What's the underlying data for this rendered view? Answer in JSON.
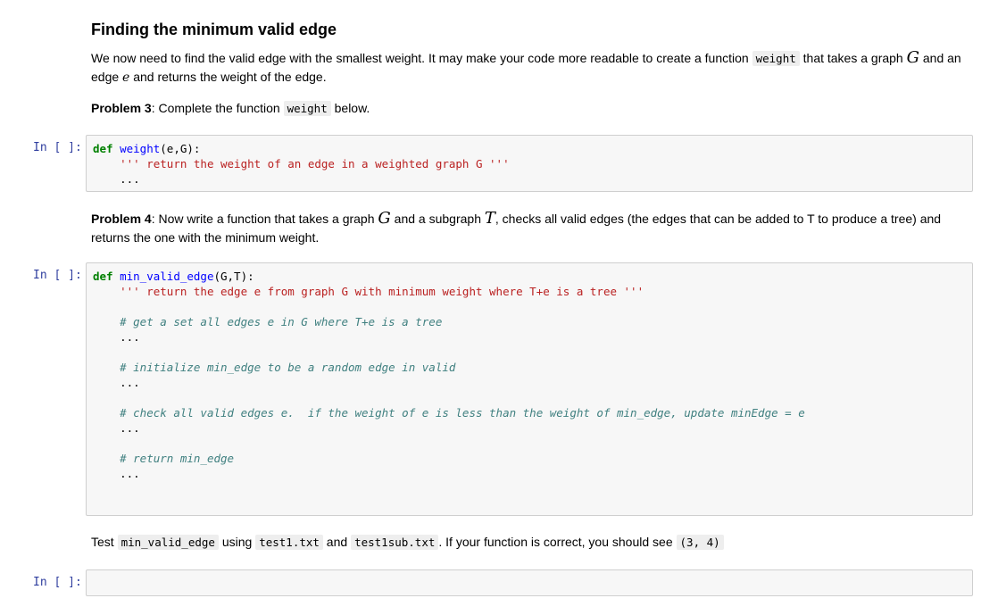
{
  "section": {
    "title": "Finding the minimum valid edge",
    "intro": {
      "t1": "We now need to find the valid edge with the smallest weight. It may make your code more readable to create a function ",
      "code1": "weight",
      "t2": " that takes a graph ",
      "m1": "G",
      "t3": " and an edge ",
      "m2": "e",
      "t4": " and returns the weight of the edge."
    }
  },
  "problem3": {
    "label": "Problem 3",
    "t1": ": Complete the function ",
    "code": "weight",
    "t2": " below."
  },
  "cell1": {
    "prompt": "In [ ]:",
    "def": "def",
    "fname": "weight",
    "args": "(e,G):",
    "doc": "''' return the weight of an edge in a weighted graph G '''",
    "ellipsis": "..."
  },
  "problem4": {
    "label": "Problem 4",
    "t1": ": Now write a function that takes a graph ",
    "m1": "G",
    "t2": " and a subgraph ",
    "m2": "T",
    "t3": ", checks all valid edges (the edges that can be added to T to produce a tree) and returns the one with the minimum weight."
  },
  "cell2": {
    "prompt": "In [ ]:",
    "def": "def",
    "fname": "min_valid_edge",
    "args": "(G,T):",
    "doc": "''' return the edge e from graph G with minimum weight where T+e is a tree '''",
    "c1": "# get a set all edges e in G where T+e is a tree",
    "c2": "# initialize min_edge to be a random edge in valid",
    "c3": "# check all valid edges e.  if the weight of e is less than the weight of min_edge, update minEdge = e",
    "c4": "# return min_edge",
    "ellipsis": "..."
  },
  "test": {
    "t1": "Test ",
    "code1": "min_valid_edge",
    "t2": " using ",
    "code2": "test1.txt",
    "t3": " and ",
    "code3": "test1sub.txt",
    "t4": ". If your function is correct, you should see ",
    "code4": "(3, 4)"
  },
  "cell3": {
    "prompt": "In [ ]:"
  }
}
